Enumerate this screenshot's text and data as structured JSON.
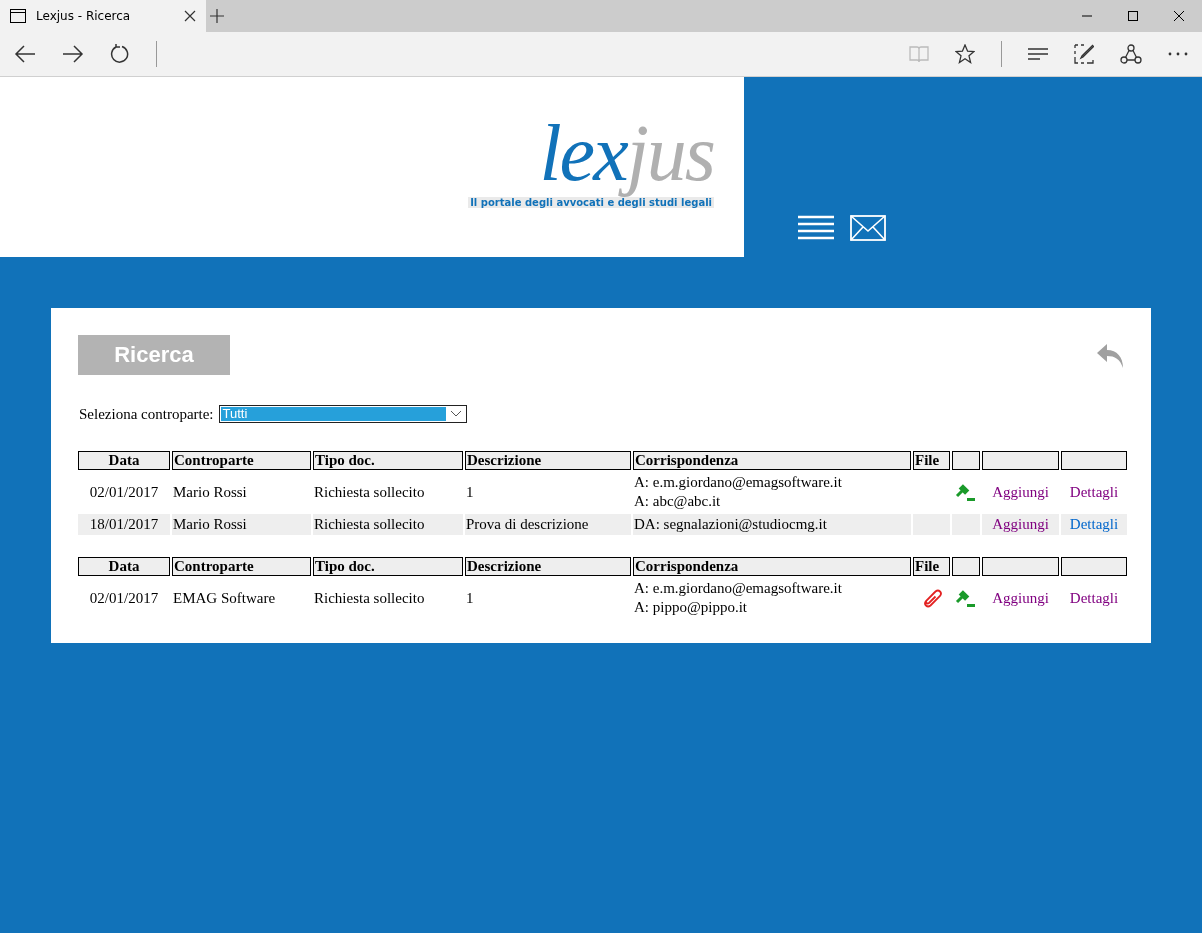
{
  "browser": {
    "tab_title": "Lexjus - Ricerca"
  },
  "header": {
    "logo": {
      "part_1": "lex",
      "part_2": "jus",
      "tagline": "Il portale degli avvocati e degli studi legali"
    }
  },
  "panel": {
    "title": "Ricerca",
    "filter": {
      "label": "Seleziona controparte:",
      "value": "Tutti"
    },
    "tables": [
      {
        "columns": [
          "Data",
          "Controparte",
          "Tipo doc.",
          "Descrizione",
          "Corrispondenza",
          "File",
          "",
          "",
          ""
        ],
        "rows": [
          {
            "date": "02/01/2017",
            "party": "Mario Rossi",
            "doc_type": "Richiesta sollecito",
            "description": "1",
            "mail": [
              "A: e.m.giordano@emagsoftware.it",
              "A: abc@abc.it"
            ],
            "attachment": false,
            "gavel": true,
            "add": "Aggiungi",
            "add_visited": true,
            "details": "Dettagli",
            "details_visited": true,
            "shaded": false
          },
          {
            "date": "18/01/2017",
            "party": "Mario Rossi",
            "doc_type": "Richiesta sollecito",
            "description": "Prova di descrizione",
            "mail": [
              "DA: segnalazioni@studiocmg.it"
            ],
            "attachment": false,
            "gavel": false,
            "add": "Aggiungi",
            "add_visited": true,
            "details": "Dettagli",
            "details_visited": false,
            "shaded": true
          }
        ]
      },
      {
        "columns": [
          "Data",
          "Controparte",
          "Tipo doc.",
          "Descrizione",
          "Corrispondenza",
          "File",
          "",
          "",
          ""
        ],
        "rows": [
          {
            "date": "02/01/2017",
            "party": "EMAG Software",
            "doc_type": "Richiesta sollecito",
            "description": "1",
            "mail": [
              "A: e.m.giordano@emagsoftware.it",
              "A: pippo@pippo.it"
            ],
            "attachment": true,
            "gavel": true,
            "add": "Aggiungi",
            "add_visited": true,
            "details": "Dettagli",
            "details_visited": true,
            "shaded": false
          }
        ]
      }
    ]
  }
}
